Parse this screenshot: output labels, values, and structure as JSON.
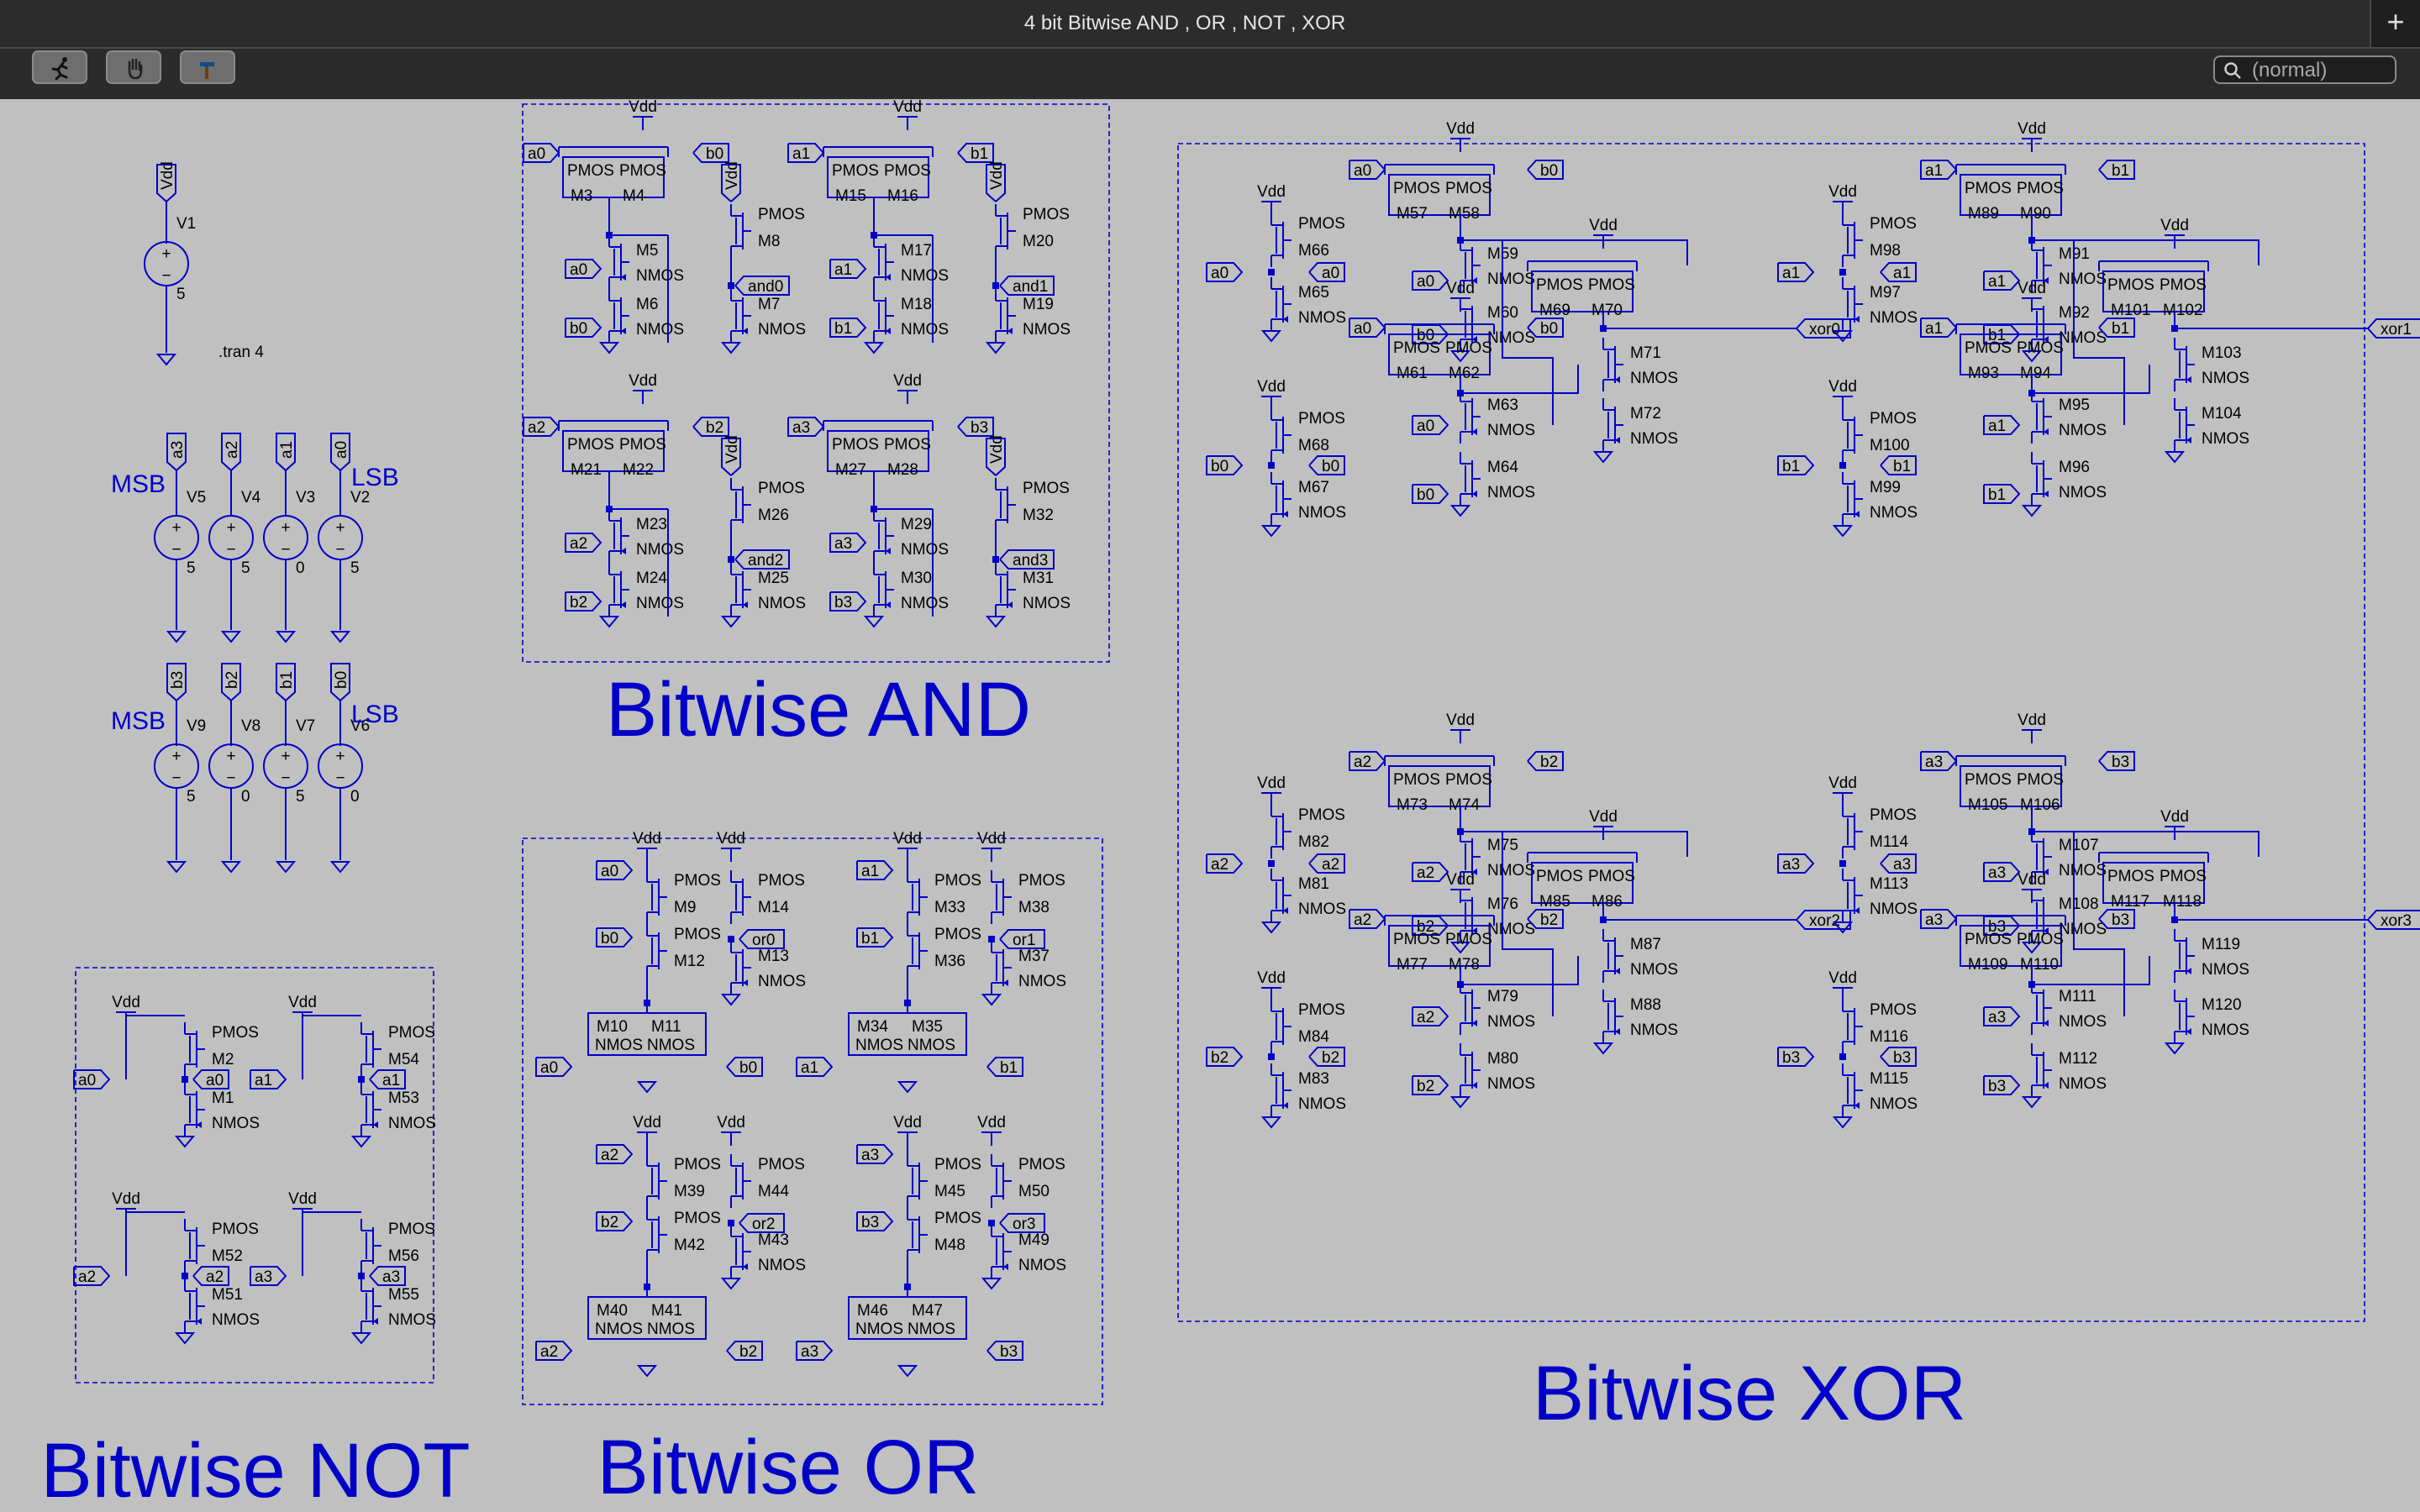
{
  "window": {
    "title": "4 bit Bitwise AND , OR , NOT , XOR",
    "new_tab_label": "+"
  },
  "toolbar": {
    "tools": [
      {
        "name": "run",
        "icon": "running-man-icon"
      },
      {
        "name": "halt",
        "icon": "hand-icon"
      },
      {
        "name": "tool",
        "icon": "hammer-icon"
      }
    ],
    "search_placeholder": "(normal)"
  },
  "schematic": {
    "section_titles": {
      "and": "Bitwise AND",
      "or": "Bitwise OR",
      "not": "Bitwise NOT",
      "xor": "Bitwise XOR"
    },
    "supply": {
      "net": "Vdd",
      "source": "V1",
      "value": "5",
      "directive": ".tran 4"
    },
    "labels": {
      "msb": "MSB",
      "lsb": "LSB"
    },
    "input_sources": [
      {
        "net": "a3",
        "name": "V5",
        "value": "5"
      },
      {
        "net": "a2",
        "name": "V4",
        "value": "5"
      },
      {
        "net": "a1",
        "name": "V3",
        "value": "0"
      },
      {
        "net": "a0",
        "name": "V2",
        "value": "5"
      },
      {
        "net": "b3",
        "name": "V9",
        "value": "5"
      },
      {
        "net": "b2",
        "name": "V8",
        "value": "0"
      },
      {
        "net": "b1",
        "name": "V7",
        "value": "5"
      },
      {
        "net": "b0",
        "name": "V6",
        "value": "0"
      }
    ],
    "and_gates": [
      {
        "a": "a0",
        "b": "b0",
        "out": "and0",
        "m": [
          "M3",
          "M4",
          "M5",
          "M6",
          "M8",
          "M7"
        ]
      },
      {
        "a": "a1",
        "b": "b1",
        "out": "and1",
        "m": [
          "M15",
          "M16",
          "M17",
          "M18",
          "M20",
          "M19"
        ]
      },
      {
        "a": "a2",
        "b": "b2",
        "out": "and2",
        "m": [
          "M21",
          "M22",
          "M23",
          "M24",
          "M26",
          "M25"
        ]
      },
      {
        "a": "a3",
        "b": "b3",
        "out": "and3",
        "m": [
          "M27",
          "M28",
          "M29",
          "M30",
          "M32",
          "M31"
        ]
      }
    ],
    "or_gates": [
      {
        "a": "a0",
        "b": "b0",
        "out": "or0",
        "m": [
          "M9",
          "M12",
          "M14",
          "M13",
          "M10",
          "M11"
        ]
      },
      {
        "a": "a1",
        "b": "b1",
        "out": "or1",
        "m": [
          "M33",
          "M36",
          "M38",
          "M37",
          "M34",
          "M35"
        ]
      },
      {
        "a": "a2",
        "b": "b2",
        "out": "or2",
        "m": [
          "M39",
          "M42",
          "M44",
          "M43",
          "M40",
          "M41"
        ]
      },
      {
        "a": "a3",
        "b": "b3",
        "out": "or3",
        "m": [
          "M45",
          "M48",
          "M50",
          "M49",
          "M46",
          "M47"
        ]
      }
    ],
    "not_gates": [
      {
        "in": "a0",
        "out": "a0",
        "m": [
          "M2",
          "M1"
        ]
      },
      {
        "in": "a1",
        "out": "a1",
        "m": [
          "M54",
          "M53"
        ]
      },
      {
        "in": "a2",
        "out": "a2",
        "m": [
          "M52",
          "M51"
        ]
      },
      {
        "in": "a3",
        "out": "a3",
        "m": [
          "M56",
          "M55"
        ]
      }
    ],
    "xor_gates": [
      {
        "a": "a0",
        "b": "b0",
        "out": "xor0",
        "m": {
          "top": [
            "M57",
            "M58"
          ],
          "s1": [
            "M59",
            "M60"
          ],
          "inva": [
            "M66",
            "M65"
          ],
          "invb": [
            "M68",
            "M67"
          ],
          "mid": [
            "M61",
            "M62"
          ],
          "s2": [
            "M63",
            "M64"
          ],
          "outp": [
            "M69",
            "M70"
          ],
          "outn": [
            "M71",
            "M72"
          ]
        }
      },
      {
        "a": "a1",
        "b": "b1",
        "out": "xor1",
        "m": {
          "top": [
            "M89",
            "M90"
          ],
          "s1": [
            "M91",
            "M92"
          ],
          "inva": [
            "M98",
            "M97"
          ],
          "invb": [
            "M100",
            "M99"
          ],
          "mid": [
            "M93",
            "M94"
          ],
          "s2": [
            "M95",
            "M96"
          ],
          "outp": [
            "M101",
            "M102"
          ],
          "outn": [
            "M103",
            "M104"
          ]
        }
      },
      {
        "a": "a2",
        "b": "b2",
        "out": "xor2",
        "m": {
          "top": [
            "M73",
            "M74"
          ],
          "s1": [
            "M75",
            "M76"
          ],
          "inva": [
            "M82",
            "M81"
          ],
          "invb": [
            "M84",
            "M83"
          ],
          "mid": [
            "M77",
            "M78"
          ],
          "s2": [
            "M79",
            "M80"
          ],
          "outp": [
            "M85",
            "M86"
          ],
          "outn": [
            "M87",
            "M88"
          ]
        }
      },
      {
        "a": "a3",
        "b": "b3",
        "out": "xor3",
        "m": {
          "top": [
            "M105",
            "M106"
          ],
          "s1": [
            "M107",
            "M108"
          ],
          "inva": [
            "M114",
            "M113"
          ],
          "invb": [
            "M116",
            "M115"
          ],
          "mid": [
            "M109",
            "M110"
          ],
          "s2": [
            "M111",
            "M112"
          ],
          "outp": [
            "M117",
            "M118"
          ],
          "outn": [
            "M119",
            "M120"
          ]
        }
      }
    ]
  }
}
